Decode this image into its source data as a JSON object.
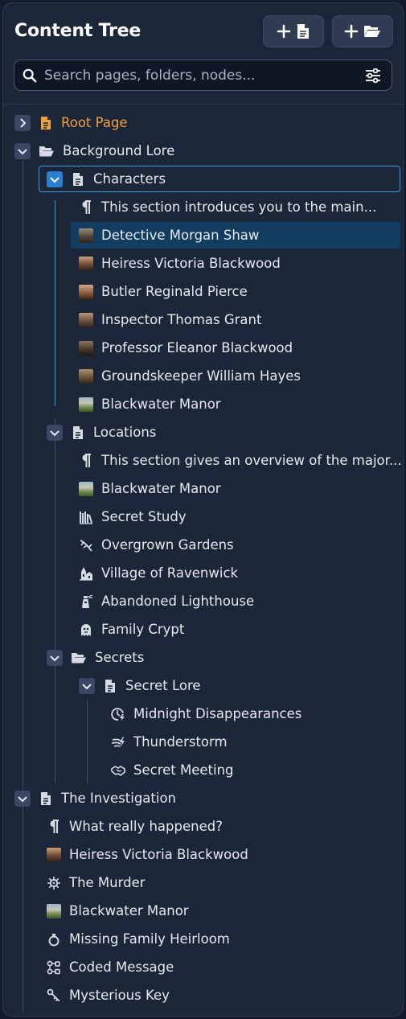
{
  "header": {
    "title": "Content Tree",
    "add_page_icon": "plus-page-icon",
    "add_folder_icon": "plus-folder-icon"
  },
  "search": {
    "placeholder": "Search pages, folders, nodes...",
    "value": ""
  },
  "colors": {
    "accent": "#3d9be0",
    "root": "#f0a040",
    "selected_bg": "#123c60",
    "panel_bg": "#1c2639"
  },
  "tree": {
    "root": {
      "label": "Root Page",
      "icon": "page-icon"
    },
    "background_lore": {
      "label": "Background Lore",
      "icon": "folder-open-icon",
      "characters": {
        "label": "Characters",
        "icon": "page-icon",
        "items": [
          {
            "label": "This section introduces you to the main...",
            "icon": "paragraph-icon"
          },
          {
            "label": "Detective Morgan Shaw",
            "icon": "portrait-thumbnail",
            "selected": true
          },
          {
            "label": "Heiress Victoria Blackwood",
            "icon": "portrait-thumbnail"
          },
          {
            "label": "Butler Reginald Pierce",
            "icon": "portrait-thumbnail"
          },
          {
            "label": "Inspector Thomas Grant",
            "icon": "portrait-thumbnail"
          },
          {
            "label": "Professor Eleanor Blackwood",
            "icon": "portrait-thumbnail"
          },
          {
            "label": "Groundskeeper William Hayes",
            "icon": "portrait-thumbnail"
          },
          {
            "label": "Blackwater Manor",
            "icon": "landscape-thumbnail"
          }
        ]
      },
      "locations": {
        "label": "Locations",
        "icon": "page-icon",
        "items": [
          {
            "label": "This section gives an overview of the major...",
            "icon": "paragraph-icon"
          },
          {
            "label": "Blackwater Manor",
            "icon": "landscape-thumbnail"
          },
          {
            "label": "Secret Study",
            "icon": "bookshelf-icon"
          },
          {
            "label": "Overgrown Gardens",
            "icon": "vine-icon"
          },
          {
            "label": "Village of Ravenwick",
            "icon": "village-icon"
          },
          {
            "label": "Abandoned Lighthouse",
            "icon": "lighthouse-icon"
          },
          {
            "label": "Family Crypt",
            "icon": "ghost-icon"
          }
        ]
      },
      "secrets": {
        "label": "Secrets",
        "icon": "folder-open-icon",
        "secret_lore": {
          "label": "Secret Lore",
          "icon": "page-icon",
          "items": [
            {
              "label": "Midnight Disappearances",
              "icon": "clock-bolt-icon"
            },
            {
              "label": "Thunderstorm",
              "icon": "storm-icon"
            },
            {
              "label": "Secret Meeting",
              "icon": "handshake-icon"
            }
          ]
        }
      }
    },
    "investigation": {
      "label": "The Investigation",
      "icon": "page-icon",
      "items": [
        {
          "label": "What really happened?",
          "icon": "paragraph-icon"
        },
        {
          "label": "Heiress Victoria Blackwood",
          "icon": "portrait-thumbnail"
        },
        {
          "label": "The Murder",
          "icon": "virus-icon"
        },
        {
          "label": "Blackwater Manor",
          "icon": "landscape-thumbnail"
        },
        {
          "label": "Missing Family Heirloom",
          "icon": "ring-icon"
        },
        {
          "label": "Coded Message",
          "icon": "diagram-icon"
        },
        {
          "label": "Mysterious Key",
          "icon": "key-icon"
        }
      ]
    }
  }
}
